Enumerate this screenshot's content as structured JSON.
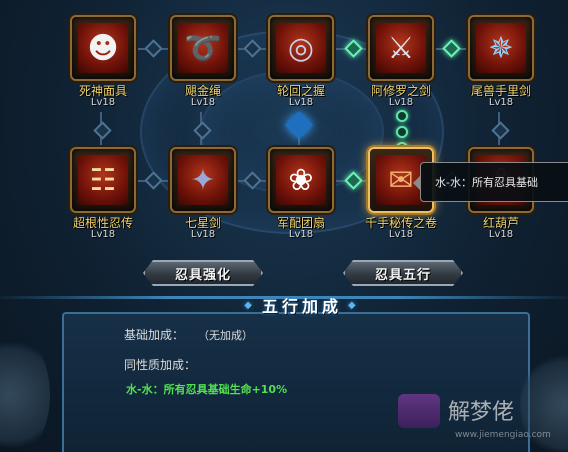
{
  "items": [
    {
      "name": "死神面具",
      "level": "Lv18",
      "icon": "demon-mask-icon",
      "selected": false
    },
    {
      "name": "飓金绳",
      "level": "Lv18",
      "icon": "golden-rope-icon",
      "selected": false
    },
    {
      "name": "轮回之握",
      "level": "Lv18",
      "icon": "spiral-orb-icon",
      "selected": false
    },
    {
      "name": "阿修罗之剑",
      "level": "Lv18",
      "icon": "asura-blade-icon",
      "selected": false
    },
    {
      "name": "尾兽手里剑",
      "level": "Lv18",
      "icon": "shuriken-icon",
      "selected": false
    },
    {
      "name": "超根性忍传",
      "level": "Lv18",
      "icon": "ninja-book-icon",
      "selected": false
    },
    {
      "name": "七星剑",
      "level": "Lv18",
      "icon": "seven-star-sword-icon",
      "selected": false
    },
    {
      "name": "军配团扇",
      "level": "Lv18",
      "icon": "war-fan-icon",
      "selected": false
    },
    {
      "name": "千手秘传之卷",
      "level": "Lv18",
      "icon": "scroll-icon",
      "selected": true
    },
    {
      "name": "红葫芦",
      "level": "Lv18",
      "icon": "red-gourd-icon",
      "selected": false
    }
  ],
  "tooltip": {
    "text": "水-水：所有忍具基础"
  },
  "buttons": {
    "strengthen": "忍具强化",
    "five_elements": "忍具五行"
  },
  "panel": {
    "title": "五行加成",
    "base_label": "基础加成：",
    "base_value": "（无加成）",
    "same_nature_label": "同性质加成：",
    "bonus_text": "水-水：所有忍具基础生命+10%"
  },
  "watermark": {
    "text": "解梦佬",
    "url": "www.jiemengiao.com"
  },
  "colors": {
    "gold_text": "#f3d36a",
    "bonus_green": "#52e052",
    "panel_border": "#3a6f97"
  }
}
